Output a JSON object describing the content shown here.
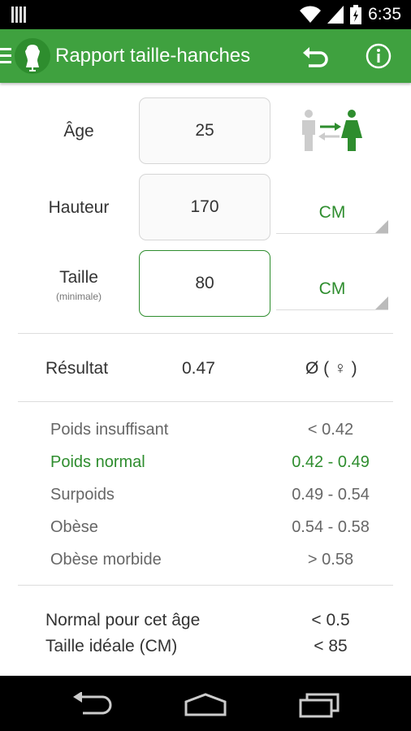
{
  "status_bar": {
    "time": "6:35"
  },
  "app_bar": {
    "title": "Rapport taille-hanches"
  },
  "form": {
    "age": {
      "label": "Âge",
      "value": "25"
    },
    "height": {
      "label": "Hauteur",
      "value": "170",
      "unit": "CM"
    },
    "waist": {
      "label": "Taille",
      "sublabel": "(minimale)",
      "value": "80",
      "unit": "CM"
    },
    "gender_toggle": "male-to-female-icon"
  },
  "result": {
    "label": "Résultat",
    "value": "0.47",
    "symbol": "Ø ( ♀ )"
  },
  "categories": [
    {
      "name": "Poids insuffisant",
      "range": "< 0.42"
    },
    {
      "name": "Poids normal",
      "range": "0.42 - 0.49"
    },
    {
      "name": "Surpoids",
      "range": "0.49 - 0.54"
    },
    {
      "name": "Obèse",
      "range": "0.54 - 0.58"
    },
    {
      "name": "Obèse morbide",
      "range": "> 0.58"
    }
  ],
  "summary": {
    "normal_label": "Normal pour cet âge",
    "normal_value": "< 0.5",
    "ideal_label": "Taille idéale (CM)",
    "ideal_value": "< 85"
  },
  "colors": {
    "accent": "#3fa13f",
    "accent_dark": "#2e8d2e"
  }
}
